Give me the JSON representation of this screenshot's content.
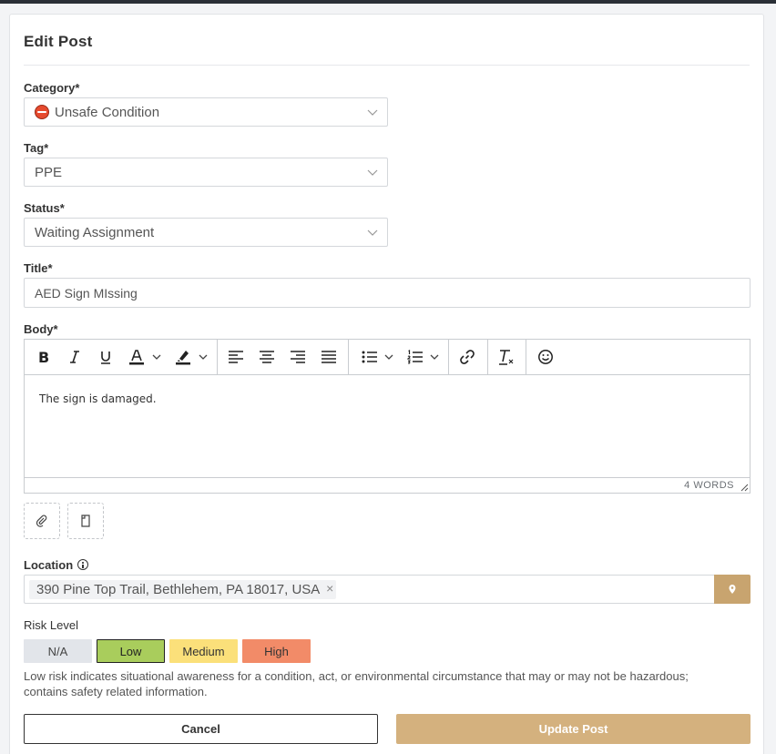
{
  "form": {
    "title": "Edit Post",
    "category": {
      "label": "Category*",
      "value": "Unsafe Condition",
      "icon": "no-entry-icon"
    },
    "tag": {
      "label": "Tag*",
      "value": "PPE"
    },
    "status": {
      "label": "Status*",
      "value": "Waiting Assignment"
    },
    "title_field": {
      "label": "Title*",
      "value": "AED Sign MIssing"
    },
    "body": {
      "label": "Body*",
      "content": "The sign is damaged.",
      "word_count": "4 WORDS",
      "toolbar": [
        "bold",
        "italic",
        "underline",
        "text-color",
        "highlight",
        "align-left",
        "align-center",
        "align-right",
        "justify",
        "bullet-list",
        "numbered-list",
        "link",
        "clear-format",
        "emoji"
      ]
    },
    "location": {
      "label": "Location",
      "value": "390 Pine Top Trail, Bethlehem, PA 18017, USA",
      "remove_glyph": "×"
    },
    "risk": {
      "label": "Risk Level",
      "options": [
        {
          "label": "N/A",
          "color": "#e2e5ea"
        },
        {
          "label": "Low",
          "color": "#a9cd5c",
          "selected": true
        },
        {
          "label": "Medium",
          "color": "#fbe07a"
        },
        {
          "label": "High",
          "color": "#f28b68"
        }
      ],
      "description": "Low risk indicates situational awareness for a condition, act, or environmental circumstance that may or may not be hazardous; contains safety related information."
    },
    "cancel_label": "Cancel",
    "submit_label": "Update Post",
    "accent_color": "#c8a46f",
    "submit_color": "#d4b17e"
  }
}
